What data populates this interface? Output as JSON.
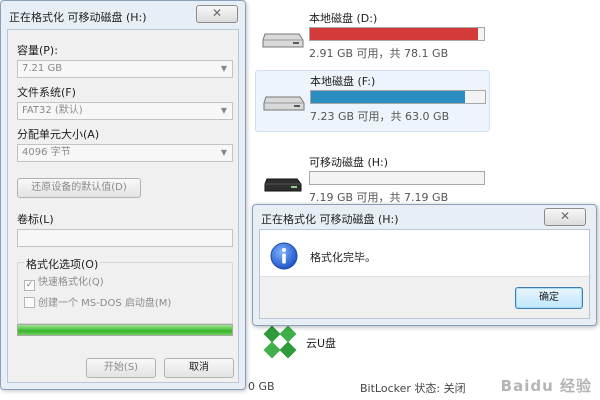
{
  "explorer": {
    "drives": [
      {
        "name": "本地磁盘 (D:)",
        "free_text": "2.91 GB 可用，共 78.1 GB",
        "used_fraction": 0.963,
        "bar_color": "#d43a3a",
        "selected": false
      },
      {
        "name": "本地磁盘 (F:)",
        "free_text": "7.23 GB 可用，共 63.0 GB",
        "used_fraction": 0.885,
        "bar_color": "#2a8fc0",
        "selected": true
      },
      {
        "name": "可移动磁盘 (H:)",
        "free_text": "7.19 GB 可用，共 7.19 GB",
        "used_fraction": 0.0,
        "bar_color": "#2a8fc0",
        "selected": false
      }
    ],
    "cloud_drive": {
      "name": "云U盘"
    },
    "status_strip": {
      "size": "0 GB",
      "bitlocker": "BitLocker 状态: 关闭"
    },
    "watermark": "Baidu 经验"
  },
  "format_dialog": {
    "title": "正在格式化 可移动磁盘 (H:)",
    "close_glyph": "✕",
    "capacity_label": "容量(P):",
    "capacity_value": "7.21 GB",
    "filesystem_label": "文件系统(F)",
    "filesystem_value": "FAT32 (默认)",
    "alloc_label": "分配单元大小(A)",
    "alloc_value": "4096 字节",
    "restore_defaults_label": "还原设备的默认值(D)",
    "volume_label": "卷标(L)",
    "volume_value": "",
    "options_title": "格式化选项(O)",
    "quick_format_label": "快速格式化(Q)",
    "quick_format_checked": true,
    "msdos_label": "创建一个 MS-DOS 启动盘(M)",
    "msdos_checked": false,
    "progress_fraction": 1.0,
    "start_label": "开始(S)",
    "cancel_label": "取消"
  },
  "message_box": {
    "title": "正在格式化 可移动磁盘 (H:)",
    "close_glyph": "✕",
    "message": "格式化完毕。",
    "ok_label": "确定",
    "icon": "info-icon"
  }
}
